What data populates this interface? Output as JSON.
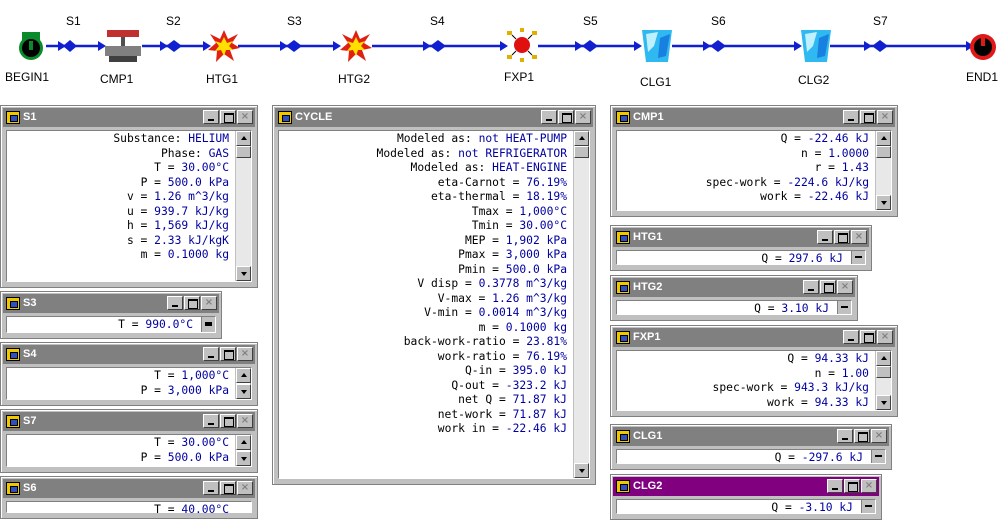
{
  "diagram": {
    "streams": [
      "S1",
      "S2",
      "S3",
      "S4",
      "S5",
      "S6",
      "S7"
    ],
    "components": [
      "BEGIN1",
      "CMP1",
      "HTG1",
      "HTG2",
      "FXP1",
      "CLG1",
      "CLG2",
      "END1"
    ]
  },
  "windows": {
    "s1": {
      "title": "S1",
      "lines": [
        {
          "l": "Substance: ",
          "v": "HELIUM"
        },
        {
          "l": "Phase: ",
          "v": "GAS"
        },
        {
          "l": "T = ",
          "v": "30.00°C"
        },
        {
          "l": "P = ",
          "v": "500.0 kPa"
        },
        {
          "l": "v = ",
          "v": "1.26 m^3/kg"
        },
        {
          "l": "u = ",
          "v": "939.7 kJ/kg"
        },
        {
          "l": "h = ",
          "v": "1,569 kJ/kg"
        },
        {
          "l": "s = ",
          "v": "2.33 kJ/kgK"
        },
        {
          "l": "m = ",
          "v": "0.1000 kg"
        }
      ]
    },
    "s3": {
      "title": "S3",
      "lines": [
        {
          "l": "T = ",
          "v": "990.0°C"
        }
      ]
    },
    "s4": {
      "title": "S4",
      "lines": [
        {
          "l": "T = ",
          "v": "1,000°C"
        },
        {
          "l": "P = ",
          "v": "3,000 kPa"
        }
      ]
    },
    "s7": {
      "title": "S7",
      "lines": [
        {
          "l": "T = ",
          "v": "30.00°C"
        },
        {
          "l": "P = ",
          "v": "500.0 kPa"
        }
      ]
    },
    "s6": {
      "title": "S6",
      "lines": [
        {
          "l": "T = ",
          "v": "40.00°C"
        }
      ]
    },
    "cycle": {
      "title": "CYCLE",
      "lines": [
        {
          "l": "Modeled as: ",
          "v": "not HEAT-PUMP"
        },
        {
          "l": "Modeled as: ",
          "v": "not REFRIGERATOR"
        },
        {
          "l": "Modeled as: ",
          "v": "HEAT-ENGINE"
        },
        {
          "l": "eta-Carnot = ",
          "v": "76.19%"
        },
        {
          "l": "eta-thermal = ",
          "v": "18.19%"
        },
        {
          "l": "Tmax = ",
          "v": "1,000°C"
        },
        {
          "l": "Tmin = ",
          "v": "30.00°C"
        },
        {
          "l": "MEP = ",
          "v": "1,902 kPa"
        },
        {
          "l": "Pmax = ",
          "v": "3,000 kPa"
        },
        {
          "l": "Pmin = ",
          "v": "500.0 kPa"
        },
        {
          "l": "V disp = ",
          "v": "0.3778 m^3/kg"
        },
        {
          "l": "V-max = ",
          "v": "1.26 m^3/kg"
        },
        {
          "l": "V-min = ",
          "v": "0.0014 m^3/kg"
        },
        {
          "l": "m = ",
          "v": "0.1000 kg"
        },
        {
          "l": "back-work-ratio = ",
          "v": "23.81%"
        },
        {
          "l": "work-ratio = ",
          "v": "76.19%"
        },
        {
          "l": "Q-in = ",
          "v": "395.0 kJ"
        },
        {
          "l": "Q-out = ",
          "v": "-323.2 kJ"
        },
        {
          "l": "net Q = ",
          "v": "71.87 kJ"
        },
        {
          "l": "net-work = ",
          "v": "71.87 kJ"
        },
        {
          "l": "work in = ",
          "v": "-22.46 kJ"
        }
      ]
    },
    "cmp1": {
      "title": "CMP1",
      "lines": [
        {
          "l": "Q = ",
          "v": "-22.46 kJ"
        },
        {
          "l": "n = ",
          "v": "1.0000"
        },
        {
          "l": "r = ",
          "v": "1.43"
        },
        {
          "l": "spec-work = ",
          "v": "-224.6 kJ/kg"
        },
        {
          "l": "work = ",
          "v": "-22.46 kJ"
        }
      ]
    },
    "htg1": {
      "title": "HTG1",
      "lines": [
        {
          "l": "Q = ",
          "v": "297.6 kJ"
        }
      ]
    },
    "htg2": {
      "title": "HTG2",
      "lines": [
        {
          "l": "Q = ",
          "v": "3.10 kJ"
        }
      ]
    },
    "fxp1": {
      "title": "FXP1",
      "lines": [
        {
          "l": "Q = ",
          "v": "94.33 kJ"
        },
        {
          "l": "n = ",
          "v": "1.00"
        },
        {
          "l": "spec-work = ",
          "v": "943.3 kJ/kg"
        },
        {
          "l": "work = ",
          "v": "94.33 kJ"
        }
      ]
    },
    "clg1": {
      "title": "CLG1",
      "lines": [
        {
          "l": "Q = ",
          "v": "-297.6 kJ"
        }
      ]
    },
    "clg2": {
      "title": "CLG2",
      "lines": [
        {
          "l": "Q = ",
          "v": "-3.10 kJ"
        }
      ]
    }
  },
  "window_buttons": {
    "minimize": "_",
    "maximize": "□",
    "close": "×"
  },
  "colors": {
    "value_text": "#0000a0",
    "title_bar": "#808080",
    "active_title_bar": "#800080",
    "panel": "#c0c0c0",
    "flow_line": "#0000cc"
  }
}
